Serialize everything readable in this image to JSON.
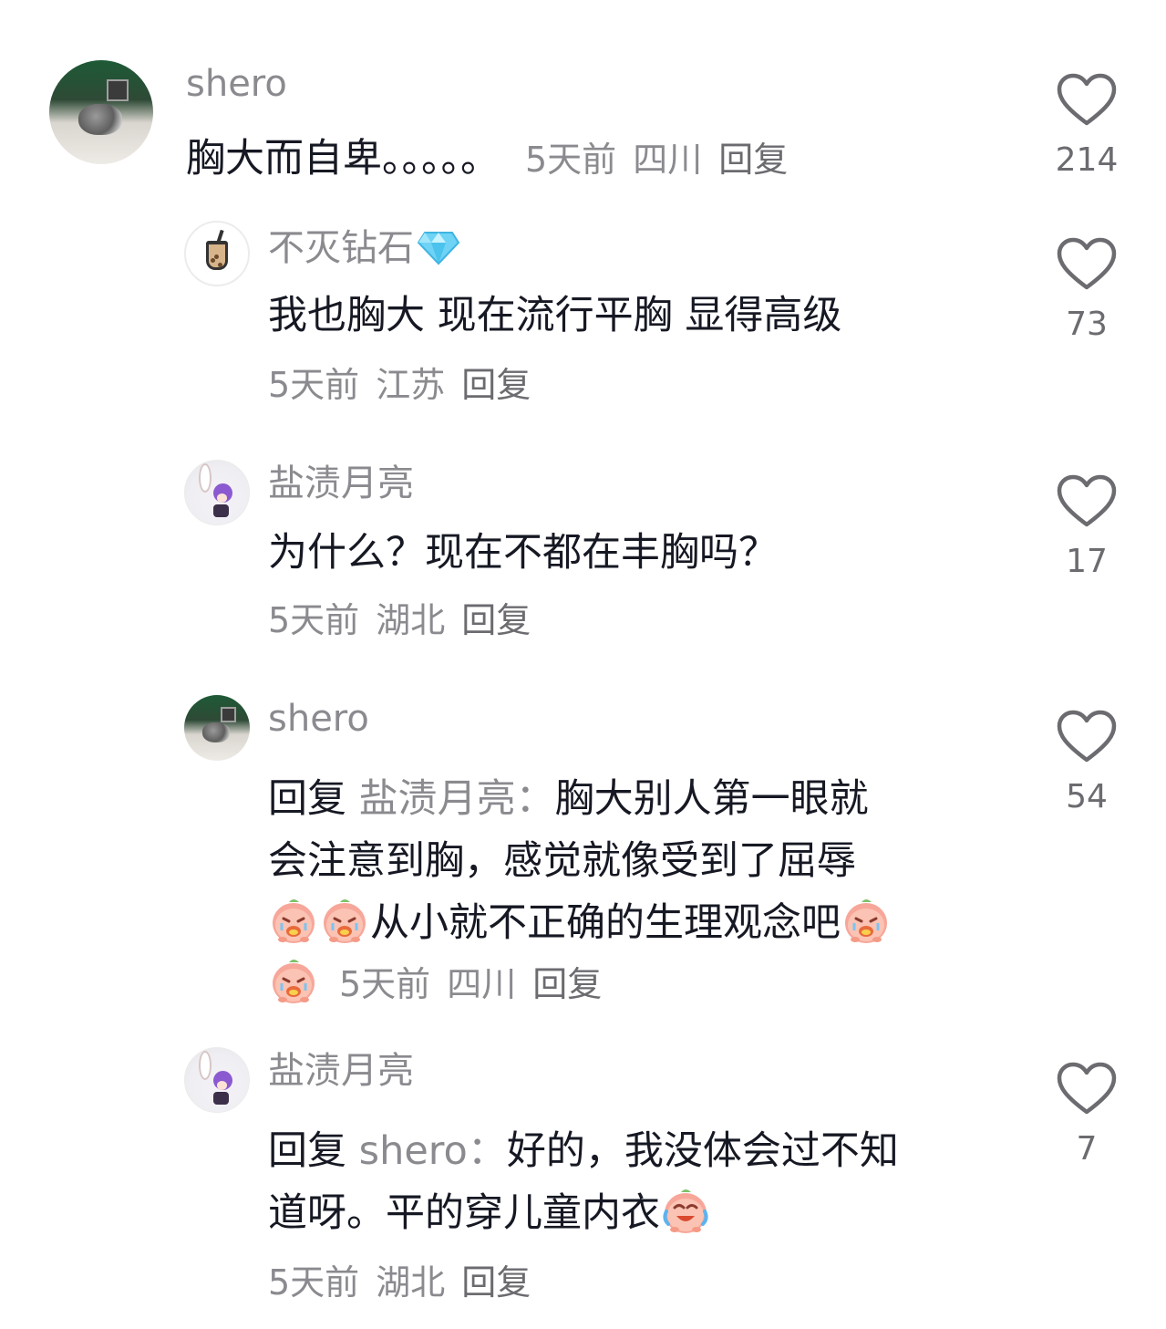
{
  "comments": [
    {
      "user": "shero",
      "text": "胸大而自卑。。。。。",
      "time": "5天前",
      "location": "四川",
      "reply_label": "回复",
      "likes": "214"
    },
    {
      "user": "不灭钻石",
      "user_badge": "diamond-icon",
      "text": "我也胸大 现在流行平胸 显得高级",
      "time": "5天前",
      "location": "江苏",
      "reply_label": "回复",
      "likes": "73"
    },
    {
      "user": "盐渍月亮",
      "text": "为什么？现在不都在丰胸吗？",
      "time": "5天前",
      "location": "湖北",
      "reply_label": "回复",
      "likes": "17"
    },
    {
      "user": "shero",
      "reply_prefix": "回复",
      "reply_target": "盐渍月亮：",
      "text_line1": "胸大别人第一眼就",
      "text_line2": "会注意到胸，感觉就像受到了屈辱",
      "text_line3": "从小就不正确的生理观念吧",
      "emoji": "peach-crying-emoji",
      "time": "5天前",
      "location": "四川",
      "reply_label": "回复",
      "likes": "54"
    },
    {
      "user": "盐渍月亮",
      "reply_prefix": "回复",
      "reply_target": "shero：",
      "text_line1": "好的，我没体会过不知",
      "text_line2": "道呀。平的穿儿童内衣",
      "emoji": "peach-laugh-cry-emoji",
      "time": "5天前",
      "location": "湖北",
      "reply_label": "回复",
      "likes": "7"
    }
  ],
  "colors": {
    "text_primary": "#161823",
    "text_secondary": "#8a8a8f",
    "heart_stroke": "#6b6b70"
  },
  "icons": {
    "like": "heart-outline-icon",
    "badge": "diamond-icon",
    "emoji": "peach-emoji"
  }
}
